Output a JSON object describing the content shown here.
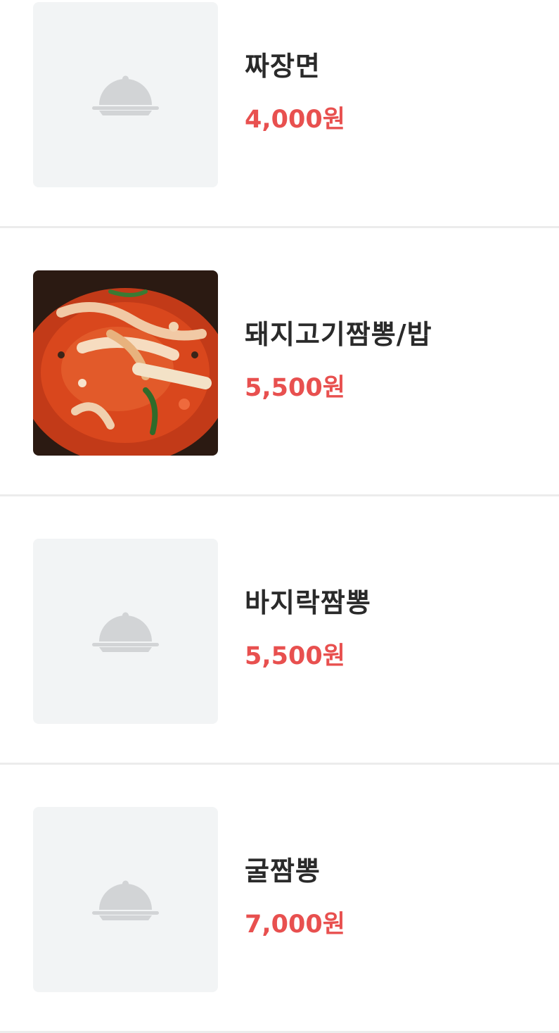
{
  "menu_items": [
    {
      "name": "짜장면",
      "price": "4,000원",
      "image": "dish-placeholder-icon"
    },
    {
      "name": "돼지고기짬뽕/밥",
      "price": "5,500원",
      "image": "food-photo"
    },
    {
      "name": "바지락짬뽕",
      "price": "5,500원",
      "image": "dish-placeholder-icon"
    },
    {
      "name": "굴짬뽕",
      "price": "7,000원",
      "image": "dish-placeholder-icon"
    }
  ],
  "colors": {
    "price": "#e8504f",
    "name": "#2a2a2a",
    "placeholder_bg": "#f2f4f5",
    "placeholder_icon": "#d2d4d6",
    "divider": "#ececec"
  }
}
